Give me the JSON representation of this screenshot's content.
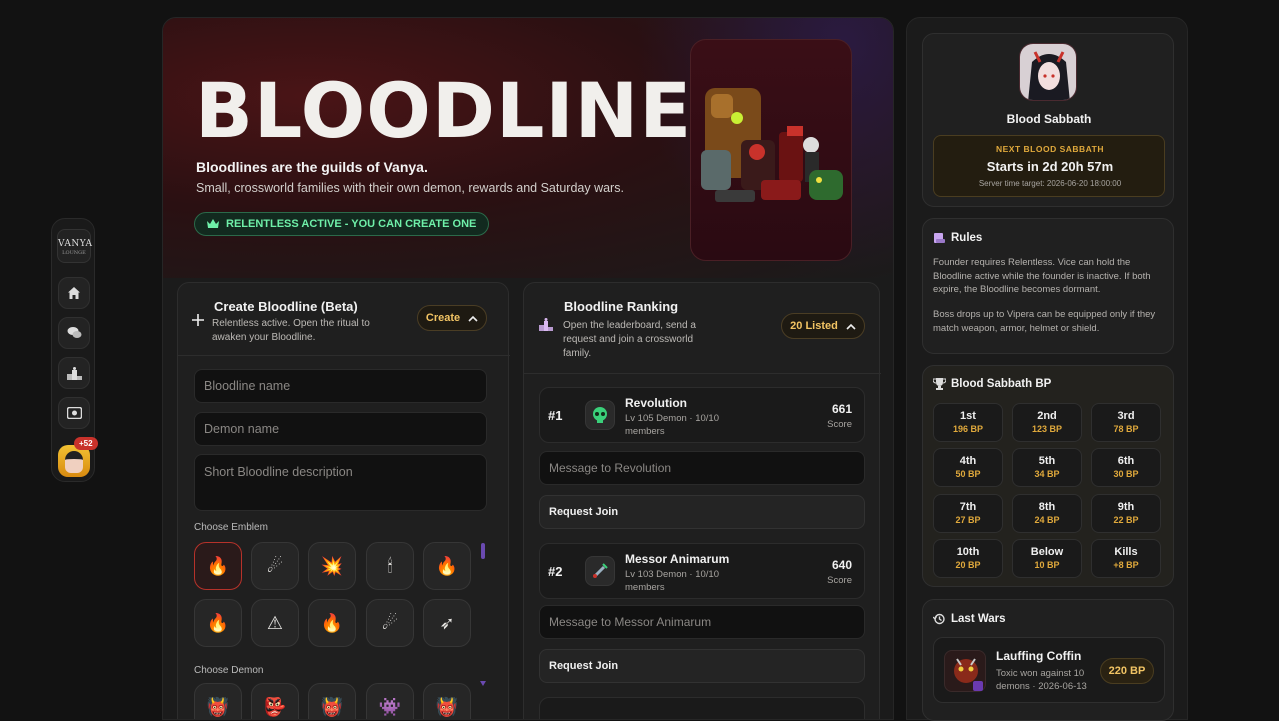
{
  "rail": {
    "logo_line1": "VANYA",
    "logo_line2": "LOUNGE",
    "badge": "+52",
    "icons": [
      "home-icon",
      "chat-icon",
      "podium-icon",
      "ticket-icon"
    ]
  },
  "hero": {
    "title": "BLOODLINES",
    "tagline": "Bloodlines are the guilds of Vanya.",
    "description": "Small, crossworld families with their own demon, rewards and Saturday wars.",
    "status_pill": "RELENTLESS ACTIVE - YOU CAN CREATE ONE"
  },
  "create": {
    "title": "Create Bloodline (Beta)",
    "subtitle_line1": "Relentless active. Open the ritual to",
    "subtitle_line2": "awaken your Bloodline.",
    "button": "Create",
    "name_placeholder": "Bloodline name",
    "demon_placeholder": "Demon name",
    "description_placeholder": "Short Bloodline description",
    "emblem_label": "Choose Emblem",
    "demon_label": "Choose Demon",
    "emblems": [
      "🔥",
      "☄",
      "💥",
      "🕯",
      "🔥",
      "🔥",
      "⚠",
      "🔥",
      "☄",
      "➶"
    ],
    "demons": [
      "👹",
      "👺",
      "👹",
      "👾",
      "👹"
    ]
  },
  "ranking": {
    "title": "Bloodline Ranking",
    "subtitle_line1": "Open the leaderboard, send a",
    "subtitle_line2": "request and join a crossworld",
    "subtitle_line3": "family.",
    "listed": "20 Listed",
    "entries": [
      {
        "rank": "#1",
        "name": "Revolution",
        "meta_line1": "Lv 105 Demon · 10/10",
        "meta_line2": "members",
        "score": "661",
        "score_label": "Score",
        "message": "Message to Revolution",
        "join": "Request Join"
      },
      {
        "rank": "#2",
        "name": "Messor Animarum",
        "meta_line1": "Lv 103 Demon · 10/10",
        "meta_line2": "members",
        "score": "640",
        "score_label": "Score",
        "message": "Message to Messor Animarum",
        "join": "Request Join"
      }
    ]
  },
  "sabbath": {
    "name": "Blood Sabbath",
    "next_label": "NEXT BLOOD SABBATH",
    "countdown": "Starts in 2d 20h 57m",
    "server_time": "Server time target: 2026-06-20 18:00:00"
  },
  "rules": {
    "title": "Rules",
    "para1": "Founder requires Relentless. Vice can hold the Bloodline active while the founder is inactive. If both expire, the Bloodline becomes dormant.",
    "para2": "Boss drops up to Vipera can be equipped only if they match weapon, armor, helmet or shield."
  },
  "bp": {
    "title": "Blood Sabbath BP",
    "cells": [
      {
        "place": "1st",
        "value": "196 BP"
      },
      {
        "place": "2nd",
        "value": "123 BP"
      },
      {
        "place": "3rd",
        "value": "78 BP"
      },
      {
        "place": "4th",
        "value": "50 BP"
      },
      {
        "place": "5th",
        "value": "34 BP"
      },
      {
        "place": "6th",
        "value": "30 BP"
      },
      {
        "place": "7th",
        "value": "27 BP"
      },
      {
        "place": "8th",
        "value": "24 BP"
      },
      {
        "place": "9th",
        "value": "22 BP"
      },
      {
        "place": "10th",
        "value": "20 BP"
      },
      {
        "place": "Below",
        "value": "10 BP"
      },
      {
        "place": "Kills",
        "value": "+8 BP"
      }
    ]
  },
  "wars": {
    "title": "Last Wars",
    "entry_name": "Lauffing Coffin",
    "entry_line1": "Toxic won against 10",
    "entry_line2": "demons · 2026-06-13",
    "entry_bp": "220 BP"
  },
  "colors": {
    "accent_gold": "#f2c464",
    "accent_green": "#6ff0a9",
    "accent_red": "#c8322b"
  }
}
